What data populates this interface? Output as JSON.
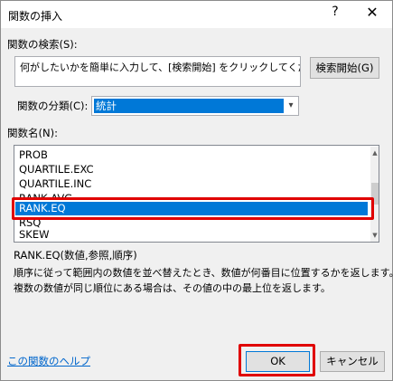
{
  "window": {
    "title": "関数の挿入",
    "help_glyph": "?",
    "close_glyph": "✕"
  },
  "search": {
    "label": "関数の検索(S):",
    "value": "何がしたいかを簡単に入力して、[検索開始] をクリックしてください。",
    "button_label": "検索開始(G)"
  },
  "category": {
    "label": "関数の分類(C):",
    "selected": "統計",
    "arrow_glyph": "▾"
  },
  "functions": {
    "label": "関数名(N):",
    "items": [
      "PROB",
      "QUARTILE.EXC",
      "QUARTILE.INC",
      "RANK.AVG",
      "RANK.EQ",
      "RSQ",
      "SKEW"
    ],
    "selected": "RANK.EQ"
  },
  "scrollbar": {
    "up_glyph": "▲",
    "down_glyph": "▼"
  },
  "details": {
    "syntax": "RANK.EQ(数値,参照,順序)",
    "description_line1": "順序に従って範囲内の数値を並べ替えたとき、数値が何番目に位置するかを返します。",
    "description_line2": "複数の数値が同じ順位にある場合は、その値の中の最上位を返します。"
  },
  "footer": {
    "help_link": "この関数のヘルプ",
    "ok_label": "OK",
    "cancel_label": "キャンセル"
  },
  "colors": {
    "selection": "#0078d7",
    "highlight_border": "#e00000",
    "link": "#0066cc"
  }
}
